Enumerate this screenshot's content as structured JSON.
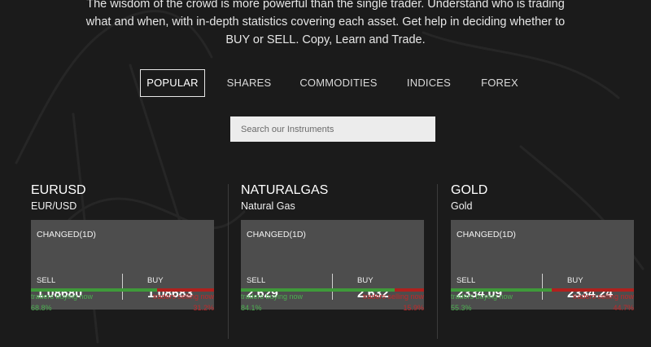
{
  "intro": {
    "line1": "The wisdom of the crowd is more powerful than the single trader. Understand who is trading",
    "line2": "what and when, with in-depth statistics covering each asset. Get help in deciding whether to",
    "line3": "BUY or SELL. Copy, Learn and Trade."
  },
  "tabs": [
    "POPULAR",
    "SHARES",
    "COMMODITIES",
    "INDICES",
    "FOREX"
  ],
  "active_tab": "POPULAR",
  "search": {
    "placeholder": "Search our Instruments"
  },
  "colors": {
    "buy": "#3f9a3a",
    "sell": "#b0211e",
    "panel": "#4d4d4d",
    "background": "#1b1b1b"
  },
  "instruments": [
    {
      "symbol": "EURUSD",
      "name": "EUR/USD",
      "changed_label": "CHANGED(1D)",
      "sell_label": "SELL",
      "sell": "1.08680",
      "buy_label": "BUY",
      "buy": "1.08683",
      "buying_label": "traders buying now",
      "buying_pct": "68.8%",
      "selling_label": "traders selling now",
      "selling_pct": "31.2%",
      "buying_fraction": 0.688
    },
    {
      "symbol": "NATURALGAS",
      "name": "Natural Gas",
      "changed_label": "CHANGED(1D)",
      "sell_label": "SELL",
      "sell": "2.629",
      "buy_label": "BUY",
      "buy": "2.632",
      "buying_label": "traders buying now",
      "buying_pct": "84.1%",
      "selling_label": "traders selling now",
      "selling_pct": "15.9%",
      "buying_fraction": 0.841
    },
    {
      "symbol": "GOLD",
      "name": "Gold",
      "changed_label": "CHANGED(1D)",
      "sell_label": "SELL",
      "sell": "2334.09",
      "buy_label": "BUY",
      "buy": "2334.24",
      "buying_label": "traders buying now",
      "buying_pct": "55.3%",
      "selling_label": "traders selling now",
      "selling_pct": "44.7%",
      "buying_fraction": 0.553
    }
  ]
}
